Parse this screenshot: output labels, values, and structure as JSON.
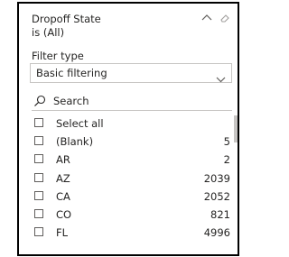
{
  "slicer": {
    "title": "Dropoff State",
    "subtitle": "is (All)",
    "header_icons": [
      "chevron-up-icon",
      "eraser-icon"
    ],
    "filter_type_label": "Filter type",
    "filter_type_value": "Basic filtering",
    "search_label": "Search"
  },
  "items": [
    {
      "label": "Select all",
      "count": ""
    },
    {
      "label": "(Blank)",
      "count": "5"
    },
    {
      "label": "AR",
      "count": "2"
    },
    {
      "label": "AZ",
      "count": "2039"
    },
    {
      "label": "CA",
      "count": "2052"
    },
    {
      "label": "CO",
      "count": "821"
    },
    {
      "label": "FL",
      "count": "4996"
    }
  ],
  "colors": {
    "border": "#000000",
    "text": "#252423",
    "control_border": "#c8c6c4",
    "checkbox_border": "#605e5c",
    "icon": "#605e5c"
  }
}
